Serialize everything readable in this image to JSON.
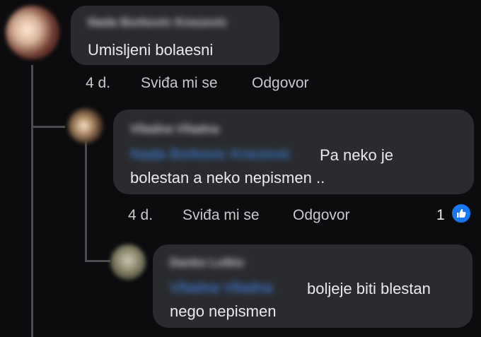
{
  "comments": [
    {
      "author": "Nada Borkovic Knezevic",
      "text": "Umisljeni bolaesni",
      "time": "4 d.",
      "like_label": "Sviđa mi se",
      "reply_label": "Odgovor"
    },
    {
      "author": "Vlladna Vlladna",
      "mention": "Nada Borkovic Knezevic",
      "text_line1": "Pa neko je",
      "text_line2": "bolestan a neko nepismen ..",
      "time": "4 d.",
      "like_label": "Sviđa mi se",
      "reply_label": "Odgovor",
      "reaction_count": "1"
    },
    {
      "author": "Danko Lolkic",
      "mention": "Vlladna Vlladna",
      "text_line1": "boljeje biti blestan",
      "text_line2": "nego nepismen"
    }
  ],
  "colors": {
    "background": "#0c0c0e",
    "bubble": "#2a2b2e",
    "mention": "#3b8df5",
    "like_badge": "#1877f2"
  }
}
